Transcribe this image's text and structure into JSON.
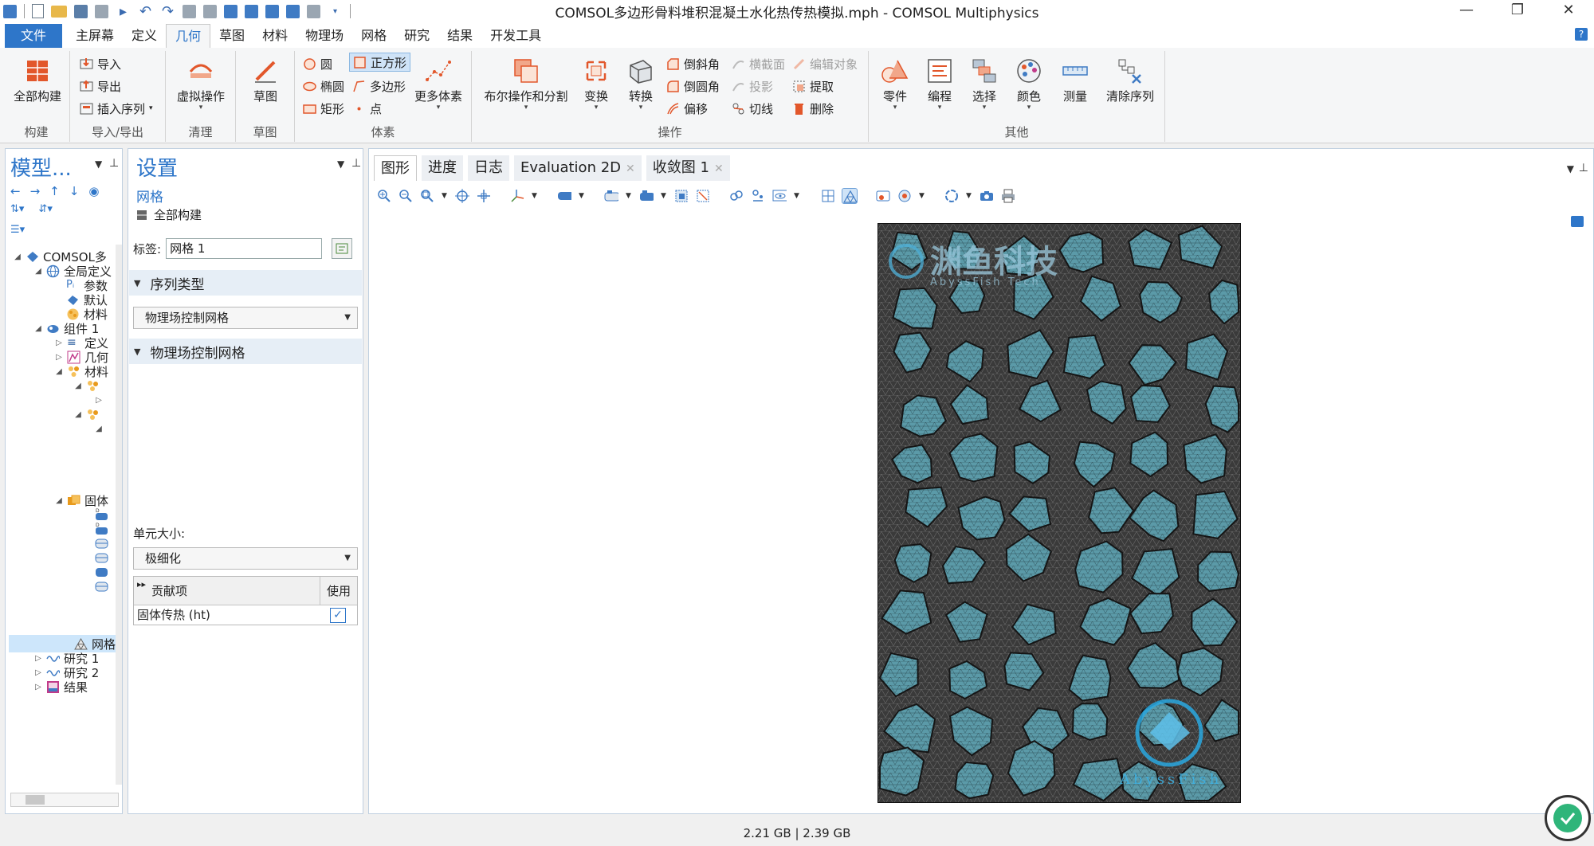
{
  "window": {
    "title": "COMSOL多边形骨料堆积混凝土水化热传热模拟.mph - COMSOL Multiphysics",
    "minimize": "—",
    "restore": "❐",
    "close": "✕"
  },
  "ribbon_tabs": [
    "文件",
    "主屏幕",
    "定义",
    "几何",
    "草图",
    "材料",
    "物理场",
    "网格",
    "研究",
    "结果",
    "开发工具"
  ],
  "help": "?",
  "ribbon": {
    "build_all": "全部构建",
    "import": "导入",
    "export": "导出",
    "insert_sequence": "插入序列",
    "virtual_ops": "虚拟操作",
    "sketch": "草图",
    "circle": "圆",
    "ellipse": "椭圆",
    "rectangle": "矩形",
    "square": "正方形",
    "polygon": "多边形",
    "point": "点",
    "more_primitives": "更多体素",
    "boolean": "布尔操作和分割",
    "transform": "变换",
    "convert": "转换",
    "chamfer": "倒斜角",
    "fillet": "倒圆角",
    "offset": "偏移",
    "cross_section": "横截面",
    "projection": "投影",
    "tangent": "切线",
    "edit_object": "编辑对象",
    "extract": "提取",
    "delete": "删除",
    "parts": "零件",
    "programming": "编程",
    "selection": "选择",
    "color": "颜色",
    "measure": "测量",
    "clear_sequence": "清除序列",
    "groups": {
      "build": "构建",
      "import_export": "导入/导出",
      "cleanup": "清理",
      "sketch": "草图",
      "primitives": "体素",
      "operations": "操作",
      "other": "其他"
    }
  },
  "model": {
    "title": "模型...",
    "tree": {
      "root": "COMSOL多",
      "global_defs": "全局定义",
      "params": "参数",
      "default": "默认",
      "materials_global": "材料",
      "component": "组件 1",
      "definitions": "定义",
      "geometry": "几何",
      "materials": "材料",
      "solid_heat": "固体",
      "mesh": "网格",
      "study1": "研究 1",
      "study2": "研究 2",
      "results": "结果"
    }
  },
  "settings": {
    "title": "设置",
    "subtitle": "网格",
    "build_all": "全部构建",
    "label_caption": "标签:",
    "label_value": "网格 1",
    "seq_type_header": "序列类型",
    "seq_type_value": "物理场控制网格",
    "physics_mesh_header": "物理场控制网格",
    "element_size_label": "单元大小:",
    "element_size_value": "极细化",
    "table": {
      "col_contribution": "贡献项",
      "col_use": "使用",
      "row_name": "固体传热 (ht)",
      "row_use_checked": true
    }
  },
  "graphics": {
    "tabs": [
      "图形",
      "进度",
      "日志",
      "Evaluation 2D",
      "收敛图 1"
    ],
    "tab_close": "✕",
    "mesh_color": "#5b9aa8",
    "watermark_top_cn": "渊鱼科技",
    "watermark_top_en": "AbyssFish Tech",
    "watermark_bottom_en": "AbyssFish"
  },
  "status": {
    "memory": "2.21 GB | 2.39 GB"
  }
}
